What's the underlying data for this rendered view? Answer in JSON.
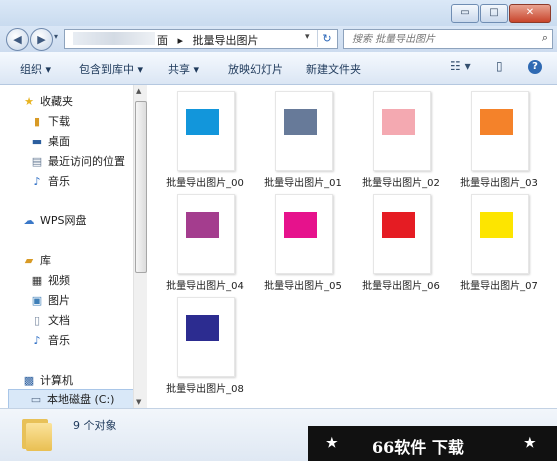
{
  "window": {
    "minimize": "▭",
    "maximize": "□",
    "close": "✕"
  },
  "address": {
    "crumb_prefix": "面",
    "crumb_sep": "▸",
    "folder": "批量导出图片",
    "dropdown": "▾",
    "refresh": "↻"
  },
  "search": {
    "placeholder": "搜索 批量导出图片"
  },
  "toolbar": {
    "organize": "组织 ▾",
    "include_library": "包含到库中 ▾",
    "share": "共享 ▾",
    "slideshow": "放映幻灯片",
    "new_folder": "新建文件夹",
    "view": "☷ ▾",
    "preview_pane": "▯",
    "help": "?"
  },
  "nav": {
    "favorites": "收藏夹",
    "downloads": "下载",
    "desktop": "桌面",
    "recent": "最近访问的位置",
    "music": "音乐",
    "wps": "WPS网盘",
    "library": "库",
    "videos": "视频",
    "pictures": "图片",
    "documents": "文档",
    "music2": "音乐",
    "computer": "计算机",
    "local_disk": "本地磁盘 (C:)"
  },
  "files": [
    {
      "name": "批量导出图片_00",
      "color": "#1296db"
    },
    {
      "name": "批量导出图片_01",
      "color": "#677a99"
    },
    {
      "name": "批量导出图片_02",
      "color": "#f4a9b1"
    },
    {
      "name": "批量导出图片_03",
      "color": "#f4822a"
    },
    {
      "name": "批量导出图片_04",
      "color": "#a43d8e"
    },
    {
      "name": "批量导出图片_05",
      "color": "#e6128c"
    },
    {
      "name": "批量导出图片_06",
      "color": "#e51c23"
    },
    {
      "name": "批量导出图片_07",
      "color": "#fde500"
    },
    {
      "name": "批量导出图片_08",
      "color": "#2c2c90"
    }
  ],
  "status": {
    "count": "9 个对象"
  },
  "watermark": {
    "star": "★",
    "text": "66软件 下载"
  }
}
